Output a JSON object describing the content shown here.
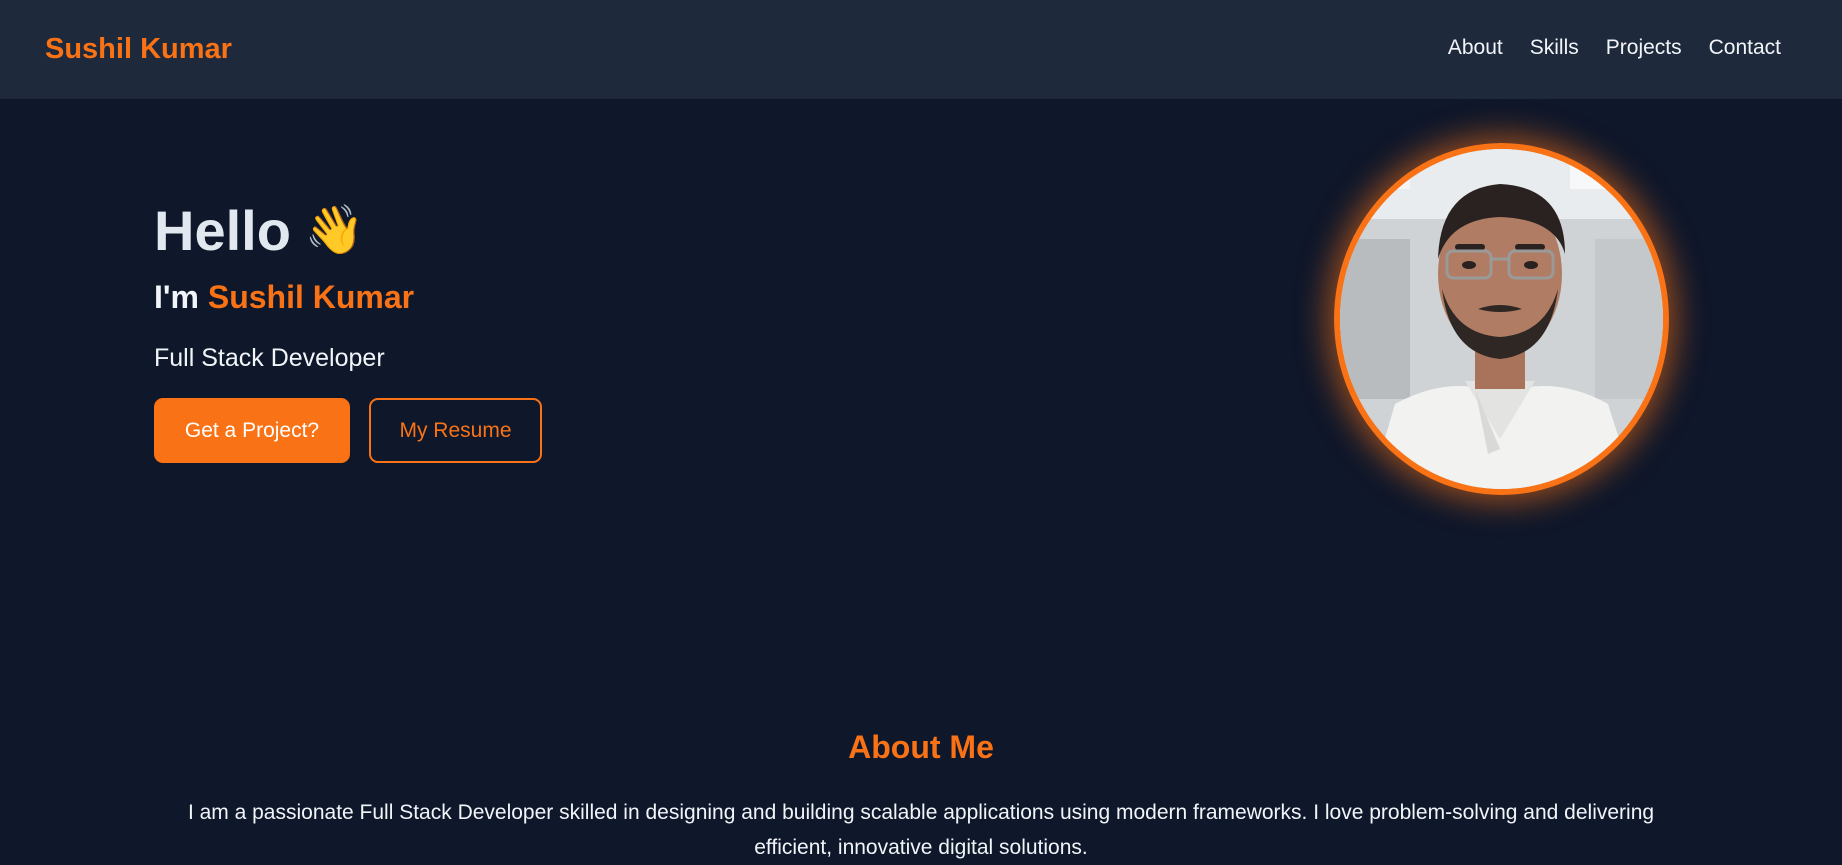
{
  "navbar": {
    "brand": "Sushil Kumar",
    "links": [
      "About",
      "Skills",
      "Projects",
      "Contact"
    ]
  },
  "hero": {
    "greeting": "Hello",
    "greeting_emoji": "👋",
    "intro_prefix": "I'm",
    "name": "Sushil Kumar",
    "role": "Full Stack Developer",
    "primary_button": "Get a Project?",
    "secondary_button": "My Resume",
    "photo_icon": "profile-photo"
  },
  "about": {
    "title": "About Me",
    "text": "I am a passionate Full Stack Developer skilled in designing and building scalable applications using modern frameworks. I love problem-solving and delivering efficient, innovative digital solutions."
  },
  "colors": {
    "accent": "#f97316",
    "background": "#0f172a",
    "navbar": "#1e293b",
    "text": "#f1f5f9"
  }
}
